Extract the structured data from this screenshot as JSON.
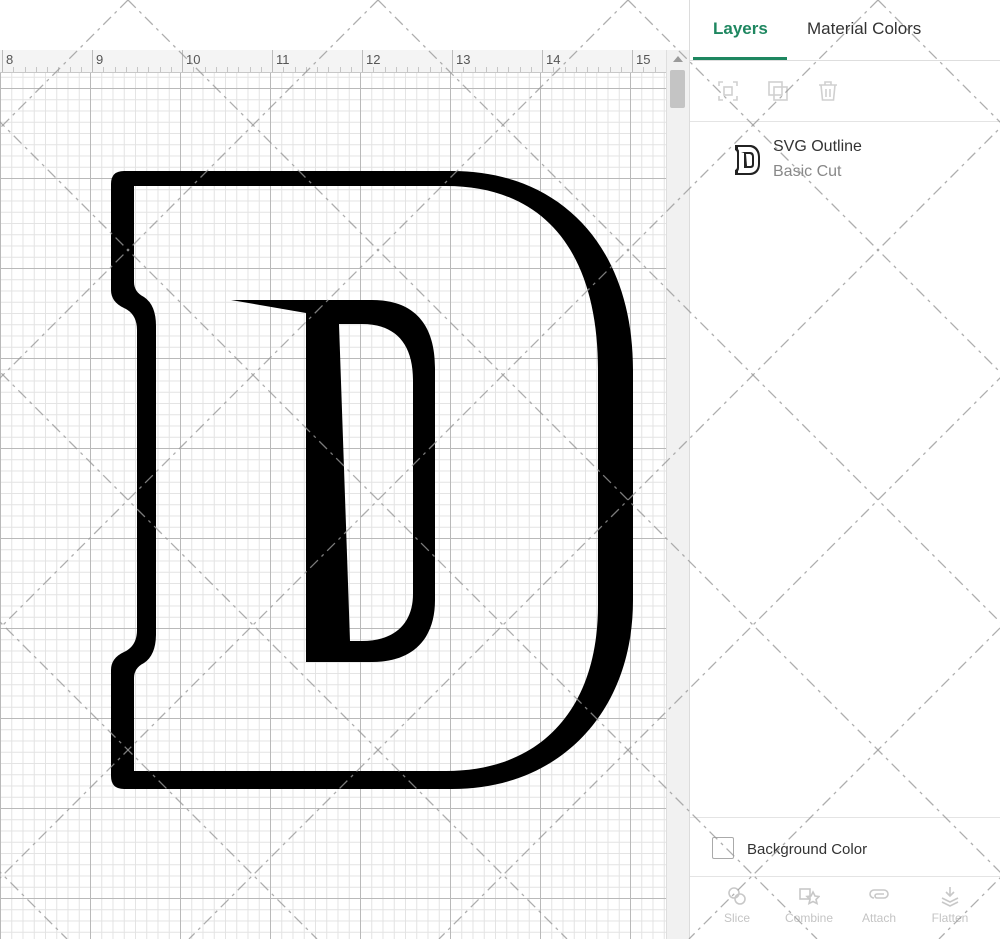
{
  "ruler": {
    "labels": [
      "8",
      "9",
      "10",
      "11",
      "12",
      "13",
      "14",
      "15"
    ]
  },
  "panel": {
    "tabs": {
      "layers": "Layers",
      "material_colors": "Material Colors"
    },
    "layer": {
      "name": "SVG Outline",
      "operation": "Basic Cut",
      "thumbnail_letter": "D"
    },
    "background": {
      "label": "Background Color",
      "checked": false
    },
    "toolbar": [
      "Slice",
      "Combine",
      "Attach",
      "Flatten"
    ]
  },
  "colors": {
    "accent": "#1e8760",
    "design": "#000000",
    "disabled": "#c4c4c4"
  },
  "icons": [
    "group-icon",
    "duplicate-icon",
    "delete-icon",
    "slice-icon",
    "combine-icon",
    "attach-icon",
    "flatten-icon",
    "scroll-up-icon"
  ]
}
